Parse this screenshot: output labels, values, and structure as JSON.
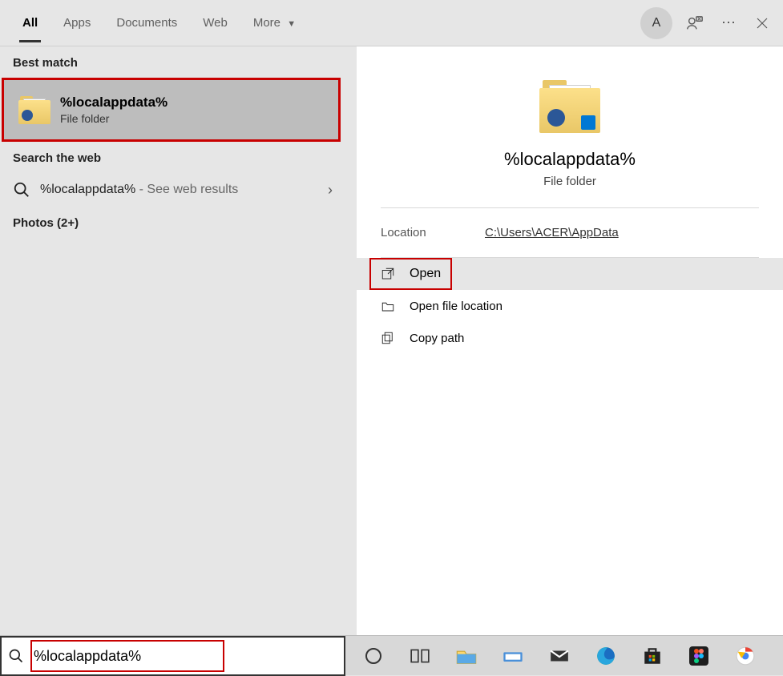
{
  "tabs": {
    "all": "All",
    "apps": "Apps",
    "documents": "Documents",
    "web": "Web",
    "more": "More"
  },
  "avatar_letter": "A",
  "sections": {
    "best_match": "Best match",
    "search_web": "Search the web",
    "photos": "Photos (2+)"
  },
  "best_match_item": {
    "title": "%localappdata%",
    "subtitle": "File folder"
  },
  "web_result": {
    "query": "%localappdata%",
    "suffix": " - See web results"
  },
  "preview": {
    "title": "%localappdata%",
    "subtitle": "File folder",
    "location_label": "Location",
    "location_value": "C:\\Users\\ACER\\AppData"
  },
  "actions": {
    "open": "Open",
    "open_file_location": "Open file location",
    "copy_path": "Copy path"
  },
  "search_input": "%localappdata%"
}
